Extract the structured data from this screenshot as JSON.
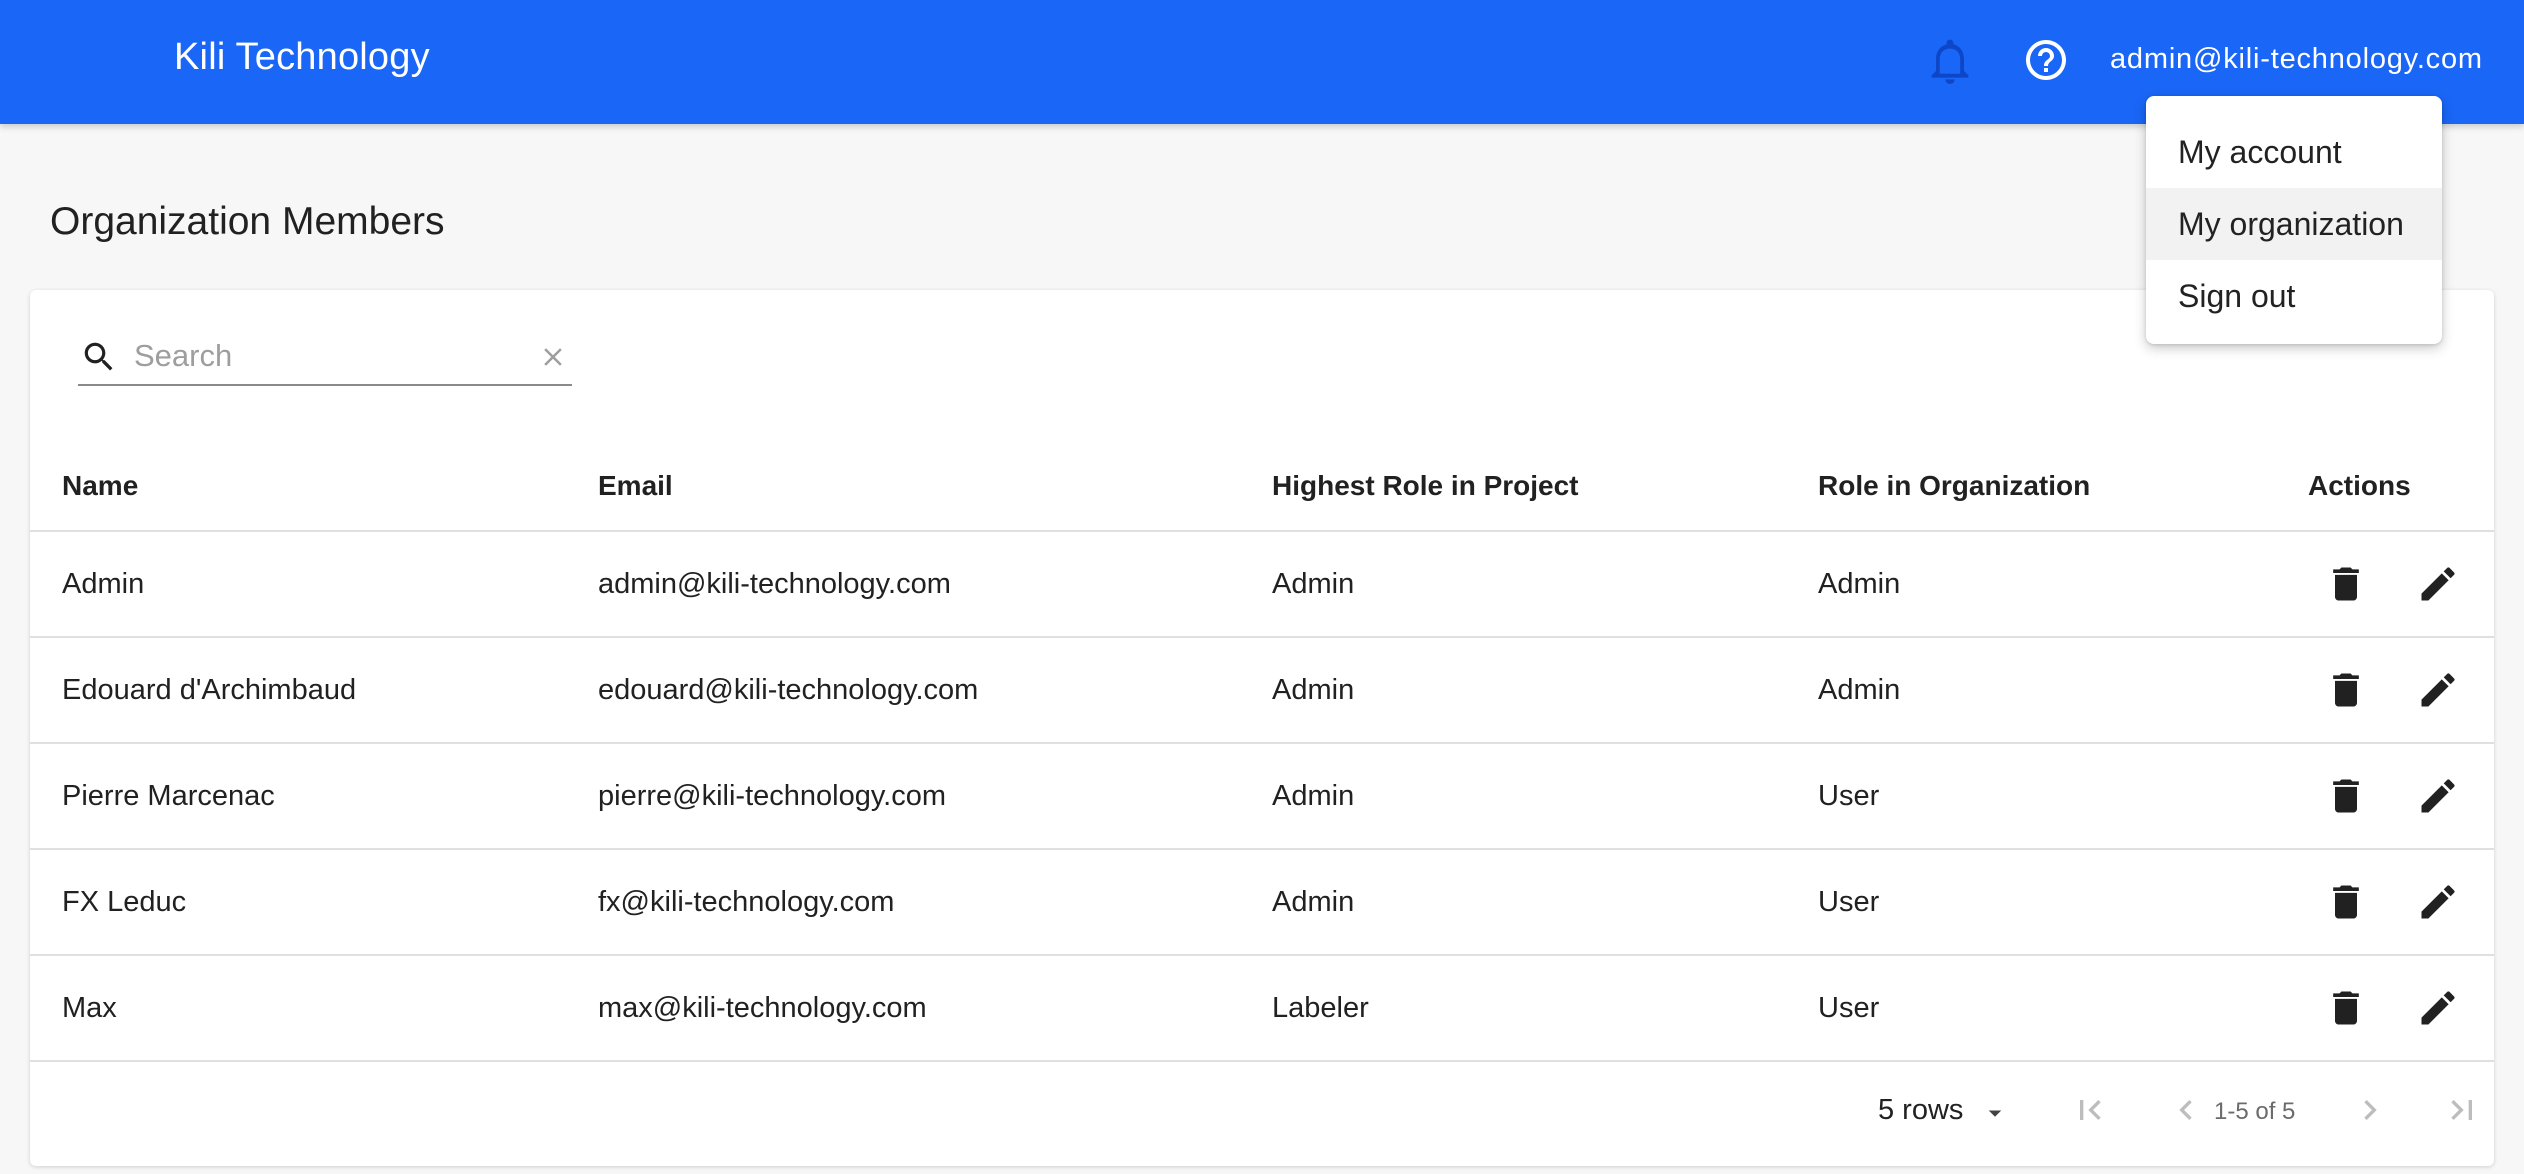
{
  "app": {
    "title": "Kili Technology"
  },
  "header": {
    "user_email": "admin@kili-technology.com",
    "icons": [
      "bell-icon",
      "help-circle-icon"
    ]
  },
  "user_menu": {
    "items": [
      {
        "label": "My account"
      },
      {
        "label": "My organization",
        "highlighted": true
      },
      {
        "label": "Sign out"
      }
    ]
  },
  "page": {
    "title": "Organization Members"
  },
  "search": {
    "placeholder": "Search",
    "value": ""
  },
  "table": {
    "columns": [
      "Name",
      "Email",
      "Highest Role in Project",
      "Role in Organization",
      "Actions"
    ],
    "rows": [
      {
        "name": "Admin",
        "email": "admin@kili-technology.com",
        "highest_role": "Admin",
        "org_role": "Admin"
      },
      {
        "name": "Edouard d'Archimbaud",
        "email": "edouard@kili-technology.com",
        "highest_role": "Admin",
        "org_role": "Admin"
      },
      {
        "name": "Pierre Marcenac",
        "email": "pierre@kili-technology.com",
        "highest_role": "Admin",
        "org_role": "User"
      },
      {
        "name": "FX Leduc",
        "email": "fx@kili-technology.com",
        "highest_role": "Admin",
        "org_role": "User"
      },
      {
        "name": "Max",
        "email": "max@kili-technology.com",
        "highest_role": "Labeler",
        "org_role": "User"
      }
    ]
  },
  "pagination": {
    "rows_per_page_label": "5 rows",
    "info": "1-5 of 5"
  },
  "colors": {
    "appbar": "#1a66f6",
    "background": "#f7f7f7",
    "card": "#ffffff",
    "menu_highlight": "#f2f2f2"
  }
}
